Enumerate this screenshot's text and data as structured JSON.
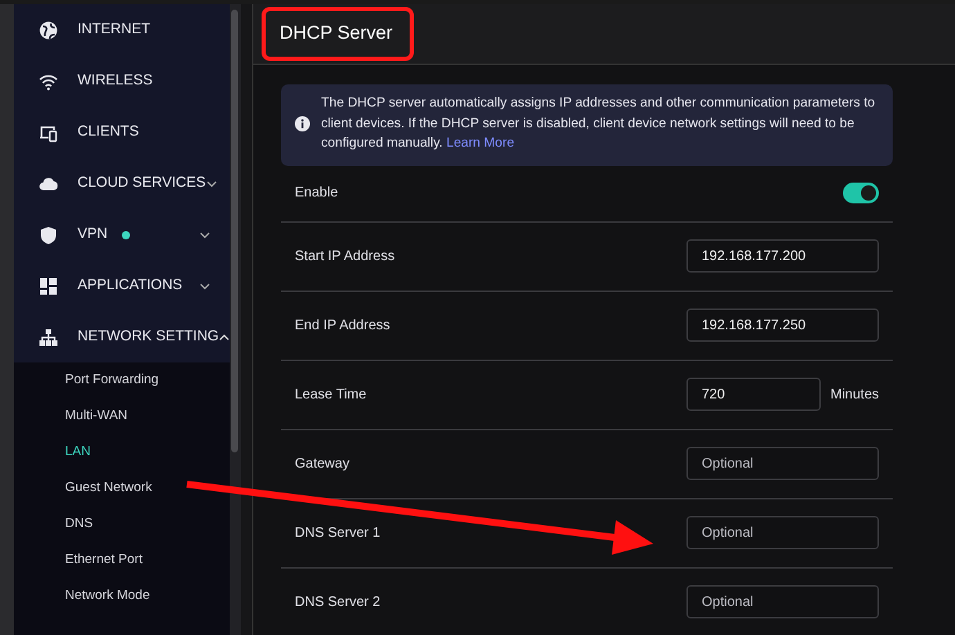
{
  "sidebar": {
    "items": [
      {
        "label": "INTERNET"
      },
      {
        "label": "WIRELESS"
      },
      {
        "label": "CLIENTS"
      },
      {
        "label": "CLOUD SERVICES",
        "expanded": false
      },
      {
        "label": "VPN",
        "expanded": false,
        "status_dot": true
      },
      {
        "label": "APPLICATIONS",
        "expanded": false
      },
      {
        "label": "NETWORK SETTING",
        "expanded": true,
        "children": [
          {
            "label": "Port Forwarding",
            "selected": false
          },
          {
            "label": "Multi-WAN",
            "selected": false
          },
          {
            "label": "LAN",
            "selected": true
          },
          {
            "label": "Guest Network",
            "selected": false
          },
          {
            "label": "DNS",
            "selected": false
          },
          {
            "label": "Ethernet Port",
            "selected": false
          },
          {
            "label": "Network Mode",
            "selected": false
          }
        ]
      }
    ]
  },
  "page": {
    "title": "DHCP Server",
    "info": {
      "text": "The DHCP server automatically assigns IP addresses and other communication parameters to client devices. If the DHCP server is disabled, client device network settings will need to be configured manually.",
      "link": "Learn More"
    },
    "rows": [
      {
        "kind": "toggle",
        "label": "Enable",
        "on": true
      },
      {
        "kind": "input",
        "label": "Start IP Address",
        "value": "192.168.177.200"
      },
      {
        "kind": "input",
        "label": "End IP Address",
        "value": "192.168.177.250"
      },
      {
        "kind": "input_unit",
        "label": "Lease Time",
        "value": "720",
        "unit": "Minutes"
      },
      {
        "kind": "input",
        "label": "Gateway",
        "placeholder": "Optional"
      },
      {
        "kind": "input",
        "label": "DNS Server 1",
        "placeholder": "Optional"
      },
      {
        "kind": "input",
        "label": "DNS Server 2",
        "placeholder": "Optional"
      }
    ]
  }
}
